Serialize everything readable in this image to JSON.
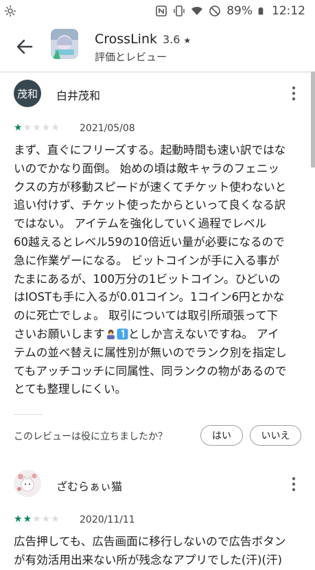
{
  "status_bar": {
    "battery": "89%",
    "time": "12:12"
  },
  "app_bar": {
    "app_name": "CrossLink",
    "rating": "3.6",
    "star_glyph": "★",
    "subtitle": "評価とレビュー"
  },
  "reviews": [
    {
      "avatar_text": "茂和",
      "author": "白井茂和",
      "stars": 1,
      "date": "2021/05/08",
      "body_lines": [
        "まず、直ぐにフリーズする。起動時間も速い訳ではな",
        "いのでかなり面倒。 始めの頃は敵キャラのフェニッ",
        "クスの方が移動スピードが速くてチケット使わないと",
        "追い付けず、チケット使ったからといって良くなる訳",
        "ではない。 アイテムを強化していく過程でレベル",
        "60越えるとレベル59の10倍近い量が必要になるので",
        "急に作業ゲーになる。 ビットコインが手に入る事が",
        "たまにあるが、100万分の1ビットコイン。ひどいの",
        "はIOSTも手に入るが0.01コイン。1コイン6円とかな",
        "のに死亡でしょ。 取引については取引所頑張って下",
        "さいお願いします",
        "としか言えないですね。 アイ",
        "テムの並べ替えに属性別が無いのでランク別を指定し",
        "てもアッチコッチに同属性、同ランクの物があるので",
        "とても整理しにくい。"
      ],
      "helpful_question": "このレビューは役に立ちましたか？",
      "yes_label": "はい",
      "no_label": "いいえ"
    },
    {
      "author": "ざむらぁぃ猫",
      "stars": 2,
      "date": "2020/11/11",
      "body_lines": [
        "広告押しても、広告画面に移行しないので広告ボタン",
        "が有効活用出来ない所が残念なアプリでした(汗)(汗)"
      ]
    }
  ],
  "colors": {
    "star_active": "#01875f",
    "star_inactive": "#dadce0",
    "avatar_bg": "#37474f"
  }
}
